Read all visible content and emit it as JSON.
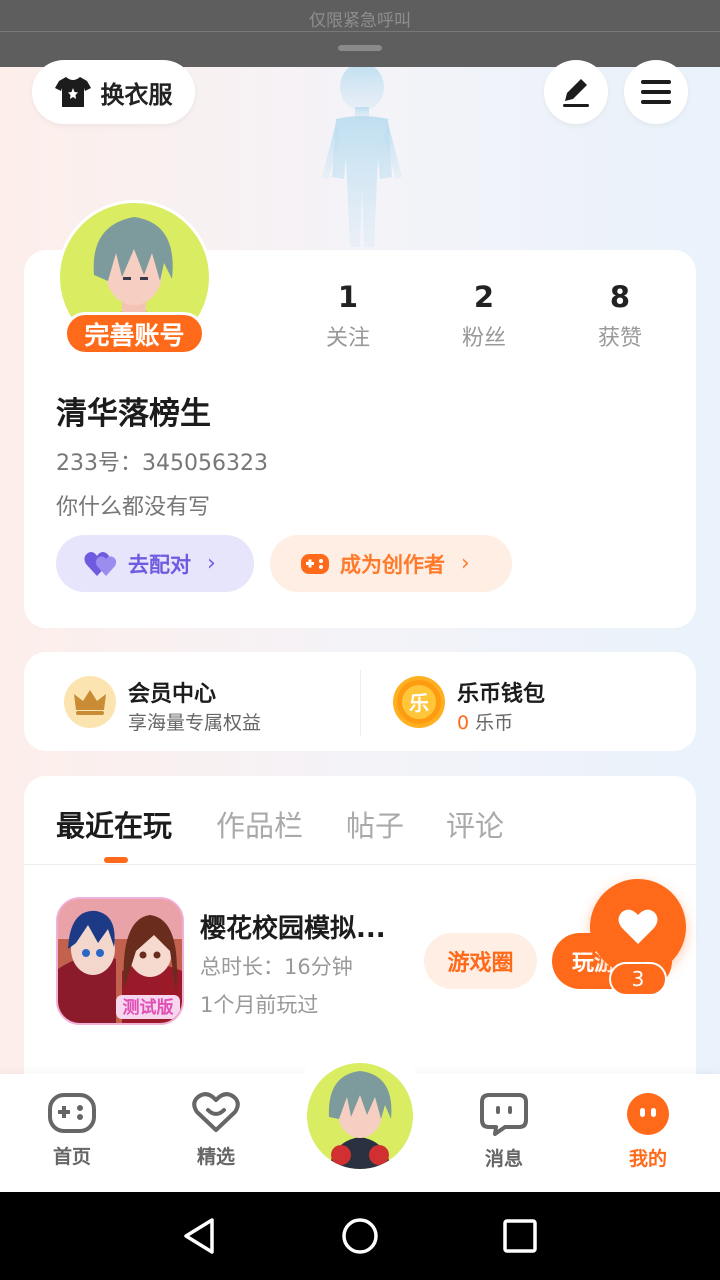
{
  "status_bar": {
    "emergency_text": "仅限紧急呼叫"
  },
  "header": {
    "outfit_label": "换衣服"
  },
  "profile": {
    "complete_badge": "完善账号",
    "stats": [
      {
        "num": "1",
        "label": "关注"
      },
      {
        "num": "2",
        "label": "粉丝"
      },
      {
        "num": "8",
        "label": "获赞"
      }
    ],
    "username": "清华落榜生",
    "user_id": "233号：345056323",
    "bio": "你什么都没有写",
    "match_label": "去配对",
    "creator_label": "成为创作者"
  },
  "wallet": {
    "vip_title": "会员中心",
    "vip_sub": "享海量专属权益",
    "vip_icon_text": "",
    "coin_icon_text": "乐",
    "coin_title": "乐币钱包",
    "coin_amount": "0",
    "coin_unit": "乐币"
  },
  "tabs": [
    {
      "label": "最近在玩",
      "active": true
    },
    {
      "label": "作品栏",
      "active": false
    },
    {
      "label": "帖子",
      "active": false
    },
    {
      "label": "评论",
      "active": false
    }
  ],
  "recent_game": {
    "name": "樱花校园模拟...",
    "duration": "总时长：16分钟",
    "last_played": "1个月前玩过",
    "circle_button": "游戏圈",
    "play_button": "玩游",
    "icon_badge": "测试版"
  },
  "floating": {
    "count": "3"
  },
  "bottom_nav": {
    "items": [
      {
        "label": "首页"
      },
      {
        "label": "精选"
      },
      {
        "label": "消息"
      },
      {
        "label": "我的"
      }
    ]
  },
  "colors": {
    "accent": "#ff6a1a",
    "purple": "#6d5be0",
    "avatar_bg": "#d9ec62"
  }
}
